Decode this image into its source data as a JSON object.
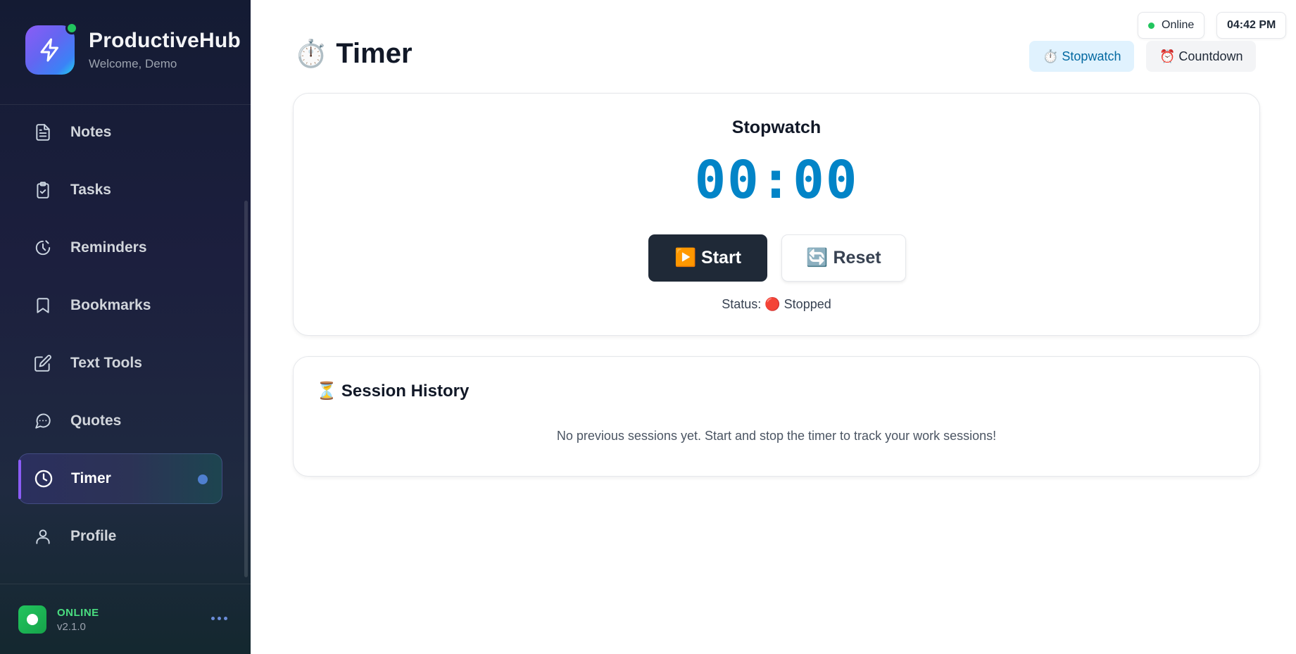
{
  "sidebar": {
    "brand_title": "ProductiveHub",
    "brand_subtitle": "Welcome, Demo",
    "items": [
      {
        "label": "Notes",
        "icon": "file-text-icon"
      },
      {
        "label": "Tasks",
        "icon": "clipboard-check-icon"
      },
      {
        "label": "Reminders",
        "icon": "clock-alert-icon"
      },
      {
        "label": "Bookmarks",
        "icon": "bookmark-icon"
      },
      {
        "label": "Text Tools",
        "icon": "edit-icon"
      },
      {
        "label": "Quotes",
        "icon": "chat-bubble-icon"
      },
      {
        "label": "Timer",
        "icon": "clock-icon",
        "active": true
      },
      {
        "label": "Profile",
        "icon": "user-icon"
      }
    ],
    "footer": {
      "status": "ONLINE",
      "version": "v2.1.0"
    }
  },
  "header": {
    "title_emoji": "⏱️",
    "title": "Timer",
    "connection_status": "Online",
    "clock": "04:42 PM",
    "modes": [
      {
        "label": "⏱️ Stopwatch",
        "active": true
      },
      {
        "label": "⏰ Countdown",
        "active": false
      }
    ]
  },
  "timer": {
    "title": "Stopwatch",
    "display": "00:00",
    "start_label": "▶️ Start",
    "reset_label": "🔄 Reset",
    "status_text": "Status: 🔴 Stopped"
  },
  "history": {
    "emoji": "⏳",
    "title": "Session History",
    "empty_message": "No previous sessions yet. Start and stop the timer to track your work sessions!"
  },
  "colors": {
    "accent": "#0284c7",
    "sidebar_bg": "#1c1f3e",
    "online": "#22c55e",
    "active_indicator": "#8b5cf6"
  }
}
